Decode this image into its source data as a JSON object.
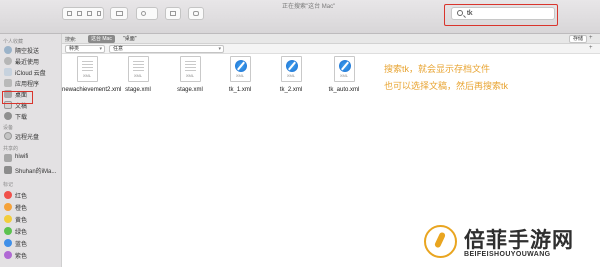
{
  "window": {
    "title": "正在搜索\"这台 Mac\""
  },
  "search": {
    "query": "tk"
  },
  "scope": {
    "label": "搜索:",
    "this_mac": "这台 Mac",
    "desktop": "\"桌面\"",
    "save": "存储",
    "add": "+"
  },
  "filter": {
    "kind": "种类",
    "value": "任意",
    "add": "+"
  },
  "sidebar": {
    "favorites_heading": "个人收藏",
    "favorites": [
      {
        "label": "隔空投送",
        "icon": "airdrop-icon"
      },
      {
        "label": "最近使用",
        "icon": "recents-icon"
      },
      {
        "label": "iCloud 云盘",
        "icon": "cloud-icon"
      },
      {
        "label": "应用程序",
        "icon": "applications-icon"
      },
      {
        "label": "桌面",
        "icon": "desktop-icon"
      },
      {
        "label": "文稿",
        "icon": "documents-icon"
      },
      {
        "label": "下载",
        "icon": "downloads-icon"
      }
    ],
    "devices_heading": "设备",
    "devices": [
      {
        "label": "远程光盘",
        "icon": "disc-icon"
      }
    ],
    "shared_heading": "共享的",
    "shared": [
      {
        "label": "hiwifi",
        "icon": "network-icon"
      },
      {
        "label": "Shuhan的iMa...",
        "icon": "imac-icon"
      }
    ],
    "tags_heading": "标记",
    "tags": [
      {
        "label": "红色",
        "color": "#f0504a"
      },
      {
        "label": "橙色",
        "color": "#f5a23a"
      },
      {
        "label": "黄色",
        "color": "#f2cd3c"
      },
      {
        "label": "绿色",
        "color": "#5cc24f"
      },
      {
        "label": "蓝色",
        "color": "#3f8fe8"
      },
      {
        "label": "紫色",
        "color": "#b069d4"
      }
    ]
  },
  "files": [
    {
      "name": "newachievement2.xml",
      "icon": "xml-document-icon",
      "tag": "XML"
    },
    {
      "name": "stage.xml",
      "icon": "xml-document-icon",
      "tag": "XML"
    },
    {
      "name": "stage.xml",
      "icon": "xml-document-icon",
      "tag": "XML"
    },
    {
      "name": "tk_1.xml",
      "icon": "safari-document-icon",
      "tag": "XML"
    },
    {
      "name": "tk_2.xml",
      "icon": "safari-document-icon",
      "tag": "XML"
    },
    {
      "name": "tk_auto.xml",
      "icon": "safari-document-icon",
      "tag": "XML"
    }
  ],
  "annotation": {
    "line1": "搜索tk，就会显示存档文件",
    "line2": "也可以选择文稿，然后再搜索tk",
    "color": "#e8a432"
  },
  "watermark": {
    "cn": "倍菲手游网",
    "en": "BEIFEISHOUYOUWANG"
  }
}
